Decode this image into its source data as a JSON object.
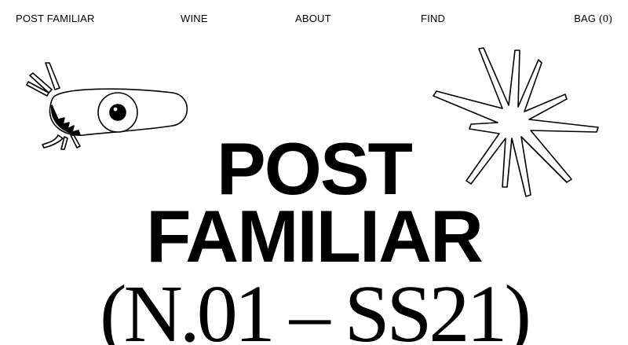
{
  "nav": {
    "logo": "POST FAMILIAR",
    "wine": "WINE",
    "about": "ABOUT",
    "find": "FIND",
    "bag_label": "BAG",
    "bag_count": "(0)"
  },
  "hero": {
    "line1": "POST",
    "line2": "FAMILIAR",
    "line3": "(N.01 – SS21)"
  },
  "illustrations": {
    "left_icon": "eye-creature-illustration",
    "right_icon": "star-burst-illustration"
  }
}
